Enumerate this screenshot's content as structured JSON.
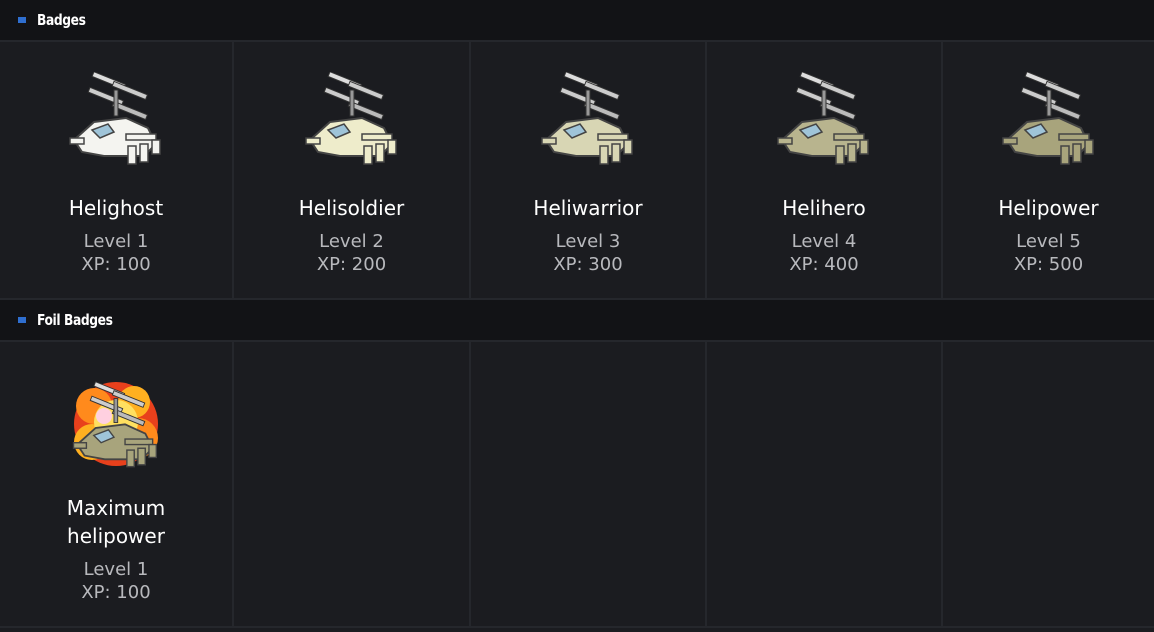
{
  "sections": {
    "badges": {
      "title": "Badges",
      "items": [
        {
          "name": "Helighost",
          "level": "Level 1",
          "xp": "XP: 100",
          "icon": "helicopter-ghost-icon",
          "tint": "#f4f4f0"
        },
        {
          "name": "Helisoldier",
          "level": "Level 2",
          "xp": "XP: 200",
          "icon": "helicopter-soldier-icon",
          "tint": "#eeeccb"
        },
        {
          "name": "Heliwarrior",
          "level": "Level 3",
          "xp": "XP: 300",
          "icon": "helicopter-warrior-icon",
          "tint": "#d8d6b4"
        },
        {
          "name": "Helihero",
          "level": "Level 4",
          "xp": "XP: 400",
          "icon": "helicopter-hero-icon",
          "tint": "#b8b48e"
        },
        {
          "name": "Helipower",
          "level": "Level 5",
          "xp": "XP: 500",
          "icon": "helicopter-power-icon",
          "tint": "#a8a47c"
        }
      ]
    },
    "foil": {
      "title": "Foil Badges",
      "items": [
        {
          "name": "Maximum helipower",
          "level": "Level 1",
          "xp": "XP: 100",
          "icon": "helicopter-explosion-icon"
        }
      ]
    }
  },
  "colors": {
    "background": "#1b1c20",
    "header": "#121316",
    "accent": "#2f6fd0"
  }
}
